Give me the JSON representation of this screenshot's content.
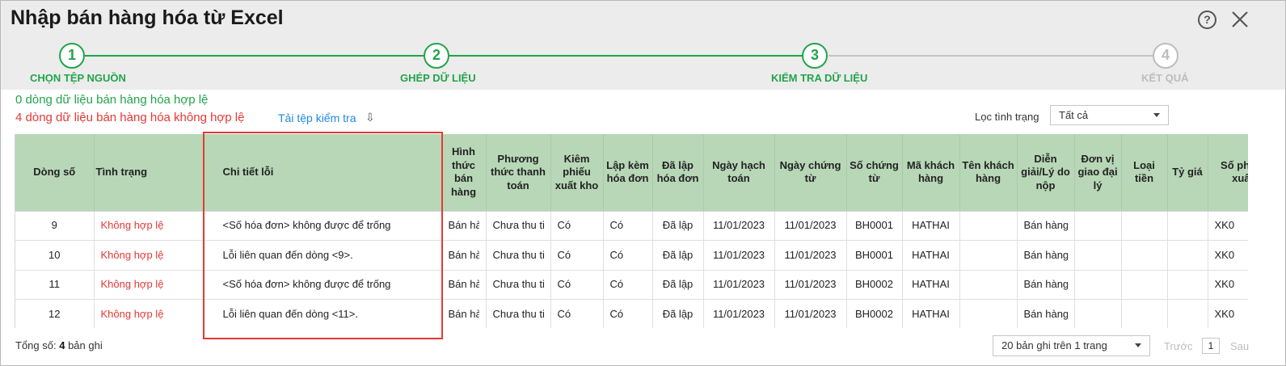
{
  "dialog": {
    "title": "Nhập bán hàng hóa từ Excel",
    "help_icon": "?",
    "colors": {
      "accent": "#22a44a",
      "error": "#e53935",
      "link": "#1e88e5",
      "header_bg": "#b7d7b7"
    }
  },
  "steps": [
    {
      "number": "1",
      "label": "CHỌN TỆP NGUỒN",
      "state": "done"
    },
    {
      "number": "2",
      "label": "GHÉP DỮ LIỆU",
      "state": "done"
    },
    {
      "number": "3",
      "label": "KIỂM TRA DỮ LIỆU",
      "state": "done"
    },
    {
      "number": "4",
      "label": "KẾT QUẢ",
      "state": "todo"
    }
  ],
  "summary": {
    "valid_text": "0 dòng dữ liệu bán hàng hóa hợp lệ",
    "invalid_text": "4 dòng dữ liệu bán hàng hóa không hợp lệ",
    "download_link": "Tải tệp kiểm tra",
    "download_icon": "⇩"
  },
  "filter": {
    "label": "Lọc tình trạng",
    "value": "Tất cả"
  },
  "table": {
    "columns": [
      "Dòng số",
      "Tình trạng",
      "Chi tiết lỗi",
      "Hình thức bán hàng",
      "Phương thức thanh toán",
      "Kiêm phiếu xuất kho",
      "Lập kèm hóa đơn",
      "Đã lập hóa đơn",
      "Ngày hạch toán",
      "Ngày chứng từ",
      "Số chứng từ",
      "Mã khách hàng",
      "Tên khách hàng",
      "Diễn giải/Lý do nộp",
      "Đơn vị giao đại lý",
      "Loại tiền",
      "Tỷ giá",
      "Số phiếu xuất"
    ],
    "rows": [
      [
        "9",
        "Không hợp lệ",
        "<Số hóa đơn> không được để trống",
        "Bán hàng hóa trong nước",
        "Chưa thu tiền",
        "Có",
        "Có",
        "Đã lập",
        "11/01/2023",
        "11/01/2023",
        "BH0001",
        "HATHAI",
        "",
        "Bán hàng hóa",
        "",
        "",
        "",
        "XK0"
      ],
      [
        "10",
        "Không hợp lệ",
        "Lỗi liên quan đến dòng <9>.",
        "Bán hàng hóa trong nước",
        "Chưa thu tiền",
        "Có",
        "Có",
        "Đã lập",
        "11/01/2023",
        "11/01/2023",
        "BH0001",
        "HATHAI",
        "",
        "Bán hàng hóa",
        "",
        "",
        "",
        "XK0"
      ],
      [
        "11",
        "Không hợp lệ",
        "<Số hóa đơn> không được để trống",
        "Bán hàng hóa trong nước",
        "Chưa thu tiền",
        "Có",
        "Có",
        "Đã lập",
        "11/01/2023",
        "11/01/2023",
        "BH0002",
        "HATHAI",
        "",
        "Bán hàng hóa",
        "",
        "",
        "",
        "XK0"
      ],
      [
        "12",
        "Không hợp lệ",
        "Lỗi liên quan đến dòng <11>.",
        "Bán hàng hóa trong nước",
        "Chưa thu tiền",
        "Có",
        "Có",
        "Đã lập",
        "11/01/2023",
        "11/01/2023",
        "BH0002",
        "HATHAI",
        "",
        "Bán hàng hóa",
        "",
        "",
        "",
        "XK0"
      ]
    ]
  },
  "footer": {
    "total_label": "Tổng số:",
    "total_count": "4",
    "total_unit": "bản ghi",
    "page_size": "20 bản ghi trên 1 trang",
    "prev": "Trước",
    "page": "1",
    "next": "Sau"
  }
}
